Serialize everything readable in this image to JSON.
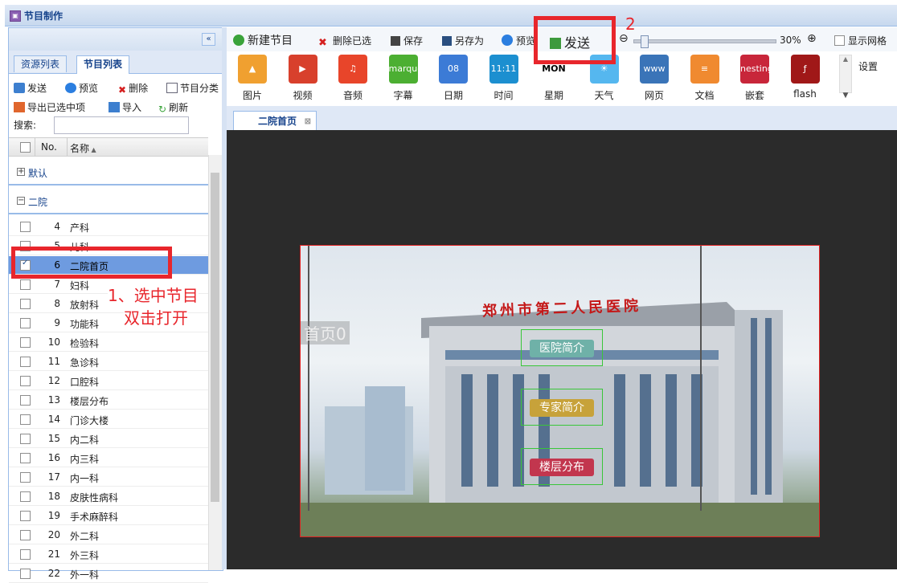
{
  "window": {
    "title": "节目制作"
  },
  "left_panel": {
    "collapse_label": "«",
    "tabs": [
      {
        "label": "资源列表",
        "active": false
      },
      {
        "label": "节目列表",
        "active": true
      }
    ],
    "actions_row1": [
      "发送",
      "预览",
      "删除",
      "节目分类"
    ],
    "actions_row2": [
      "导出已选中项",
      "导入",
      "刷新"
    ],
    "search_label": "搜索:",
    "search_value": "",
    "grid_headers": {
      "no": "No.",
      "name": "名称"
    },
    "groups": [
      {
        "label": "默认"
      },
      {
        "label": "二院"
      }
    ],
    "rows": [
      {
        "no": "4",
        "name": "产科",
        "selected": false
      },
      {
        "no": "5",
        "name": "儿科",
        "selected": false
      },
      {
        "no": "6",
        "name": "二院首页",
        "selected": true
      },
      {
        "no": "7",
        "name": "妇科",
        "selected": false
      },
      {
        "no": "8",
        "name": "放射科",
        "selected": false
      },
      {
        "no": "9",
        "name": "功能科",
        "selected": false
      },
      {
        "no": "10",
        "name": "检验科",
        "selected": false
      },
      {
        "no": "11",
        "name": "急诊科",
        "selected": false
      },
      {
        "no": "12",
        "name": "口腔科",
        "selected": false
      },
      {
        "no": "13",
        "name": "楼层分布",
        "selected": false
      },
      {
        "no": "14",
        "name": "门诊大楼",
        "selected": false
      },
      {
        "no": "15",
        "name": "内二科",
        "selected": false
      },
      {
        "no": "16",
        "name": "内三科",
        "selected": false
      },
      {
        "no": "17",
        "name": "内一科",
        "selected": false
      },
      {
        "no": "18",
        "name": "皮肤性病科",
        "selected": false
      },
      {
        "no": "19",
        "name": "手术麻醉科",
        "selected": false
      },
      {
        "no": "20",
        "name": "外二科",
        "selected": false
      },
      {
        "no": "21",
        "name": "外三科",
        "selected": false
      },
      {
        "no": "22",
        "name": "外一科",
        "selected": false
      }
    ]
  },
  "toolbar": {
    "new_program": "新建节目",
    "delete_selected": "删除已选",
    "save": "保存",
    "save_as": "另存为",
    "preview": "预览",
    "send": "发送",
    "zoom_value": "30%",
    "show_grid": "显示网格"
  },
  "palette": {
    "items": [
      {
        "label": "图片",
        "icon": "image-icon",
        "color": "#f0a030",
        "glyph": "▲"
      },
      {
        "label": "视频",
        "icon": "video-icon",
        "color": "#d8402c",
        "glyph": "▶"
      },
      {
        "label": "音频",
        "icon": "audio-icon",
        "color": "#e8452a",
        "glyph": "♫"
      },
      {
        "label": "字幕",
        "icon": "marquee-icon",
        "color": "#4caf32",
        "glyph": "marquee"
      },
      {
        "label": "日期",
        "icon": "date-icon",
        "color": "#3c7bd6",
        "glyph": "08"
      },
      {
        "label": "时间",
        "icon": "time-icon",
        "color": "#1c8fd0",
        "glyph": "11:11"
      },
      {
        "label": "星期",
        "icon": "week-icon",
        "color": "#ffffff",
        "glyph": "MON"
      },
      {
        "label": "天气",
        "icon": "weather-icon",
        "color": "#55b7ef",
        "glyph": "☀"
      },
      {
        "label": "网页",
        "icon": "web-icon",
        "color": "#3a74b8",
        "glyph": "www"
      },
      {
        "label": "文档",
        "icon": "document-icon",
        "color": "#f08a30",
        "glyph": "≡"
      },
      {
        "label": "嵌套",
        "icon": "nesting-icon",
        "color": "#c8263a",
        "glyph": "nesting"
      },
      {
        "label": "flash",
        "icon": "flash-icon",
        "color": "#a01818",
        "glyph": "ƒ"
      }
    ],
    "settings_label": "设置"
  },
  "doc_tabs": [
    {
      "label": "二院首页"
    }
  ],
  "preview": {
    "building_sign": "郑州市第二人民医院",
    "page_label": "首页0",
    "buttons": [
      "医院简介",
      "专家简介",
      "楼层分布"
    ]
  },
  "annotations": {
    "step1_line1": "1、选中节目",
    "step1_line2": "双击打开",
    "step2": "2"
  },
  "colors": {
    "accent": "#15428b",
    "highlight": "#e8262c",
    "selection": "#6e9be0"
  }
}
